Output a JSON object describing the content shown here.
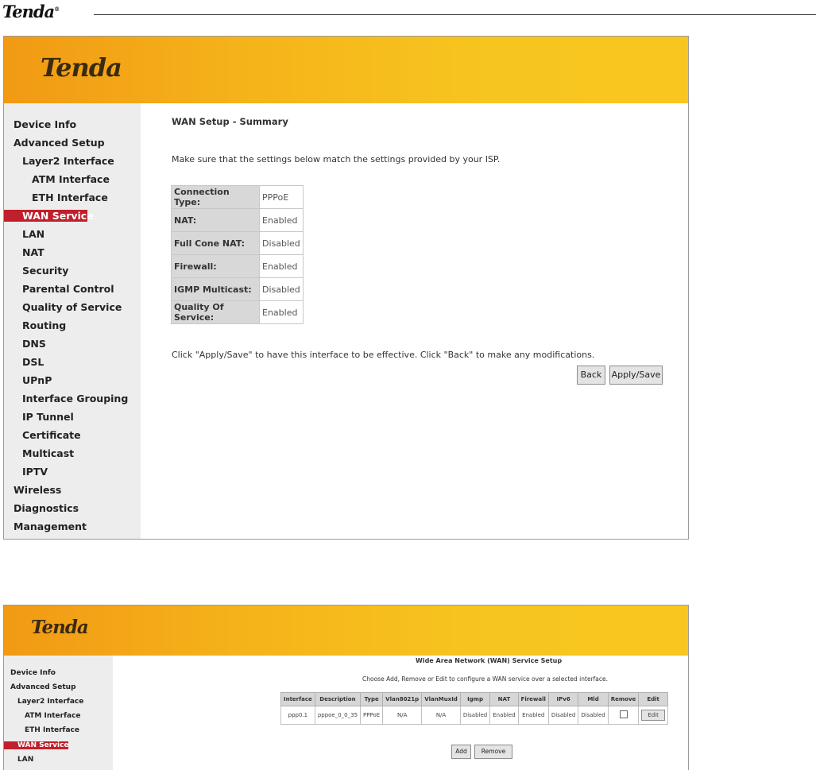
{
  "document_header": {
    "logo": "Tenda",
    "logo_mark": "®"
  },
  "screen1": {
    "brand": "Tenda",
    "sidebar": [
      "Device Info",
      "Advanced Setup",
      "Layer2 Interface",
      "ATM Interface",
      "ETH Interface",
      "WAN Service",
      "LAN",
      "NAT",
      "Security",
      "Parental Control",
      "Quality of Service",
      "Routing",
      "DNS",
      "DSL",
      "UPnP",
      "Interface Grouping",
      "IP Tunnel",
      "Certificate",
      "Multicast",
      "IPTV",
      "Wireless",
      "Diagnostics",
      "Management"
    ],
    "active_item": "WAN Service",
    "title": "WAN Setup - Summary",
    "intro": "Make sure that the settings below match the settings provided by your ISP.",
    "summary": [
      {
        "label": "Connection Type:",
        "value": "PPPoE"
      },
      {
        "label": "NAT:",
        "value": "Enabled"
      },
      {
        "label": "Full Cone NAT:",
        "value": "Disabled"
      },
      {
        "label": "Firewall:",
        "value": "Enabled"
      },
      {
        "label": "IGMP Multicast:",
        "value": "Disabled"
      },
      {
        "label": "Quality Of Service:",
        "value": "Enabled"
      }
    ],
    "footer_note": "Click \"Apply/Save\" to have this interface to be effective. Click \"Back\" to make any modifications.",
    "back_label": "Back",
    "apply_label": "Apply/Save"
  },
  "screen2": {
    "brand": "Tenda",
    "sidebar": [
      "Device Info",
      "Advanced Setup",
      "Layer2 Interface",
      "ATM Interface",
      "ETH Interface",
      "WAN Service",
      "LAN"
    ],
    "title": "Wide Area Network (WAN) Service Setup",
    "note": "Choose Add, Remove or Edit to configure a WAN service over a selected interface.",
    "columns": [
      "Interface",
      "Description",
      "Type",
      "Vlan8021p",
      "VlanMuxId",
      "Igmp",
      "NAT",
      "Firewall",
      "IPv6",
      "Mld",
      "Remove",
      "Edit"
    ],
    "row": [
      "ppp0.1",
      "pppoe_0_0_35",
      "PPPoE",
      "N/A",
      "N/A",
      "Disabled",
      "Enabled",
      "Enabled",
      "Disabled",
      "Disabled"
    ],
    "edit_label": "Edit",
    "add_label": "Add",
    "remove_label": "Remove"
  },
  "colors": {
    "banner": "#f8c61f",
    "active": "#c0202c",
    "sidebar_bg": "#ededed"
  }
}
